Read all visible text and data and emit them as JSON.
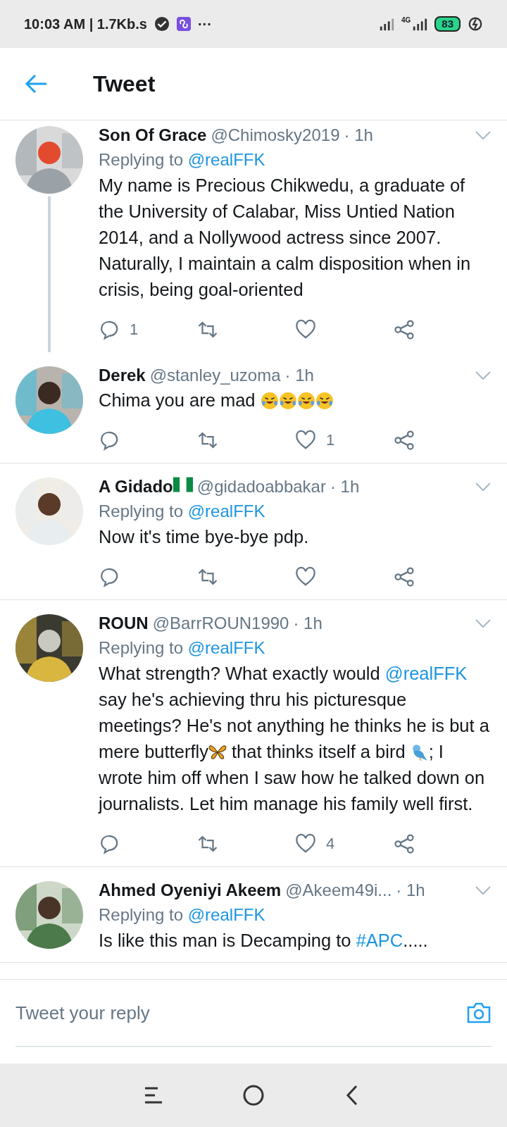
{
  "status_bar": {
    "time": "10:03 AM | 1.7Kb.s",
    "more": "···",
    "network": "4G",
    "battery": "83"
  },
  "header": {
    "title": "Tweet"
  },
  "tweets": [
    {
      "name": "Son Of Grace",
      "handle": "@Chimosky2019",
      "time": "· 1h",
      "thread_continues": true,
      "replying_to": {
        "label": "Replying to",
        "mention": "@realFFK"
      },
      "body": [
        {
          "kind": "text",
          "text": "My name is Precious Chikwedu, a graduate of the University of Calabar, Miss Untied Nation 2014, and a Nollywood actress since 2007. Naturally, I maintain a calm disposition when in crisis, being goal-oriented"
        }
      ],
      "actions": [
        {
          "kind": "reply",
          "count": "1"
        },
        {
          "kind": "retweet"
        },
        {
          "kind": "like"
        },
        {
          "kind": "share"
        }
      ]
    },
    {
      "name": "Derek",
      "handle": "@stanley_uzoma",
      "time": "· 1h",
      "thread_continues": false,
      "body": [
        {
          "kind": "text",
          "text": "Chima you are mad "
        },
        {
          "kind": "emoji_rofl"
        },
        {
          "kind": "emoji_rofl"
        },
        {
          "kind": "emoji_rofl"
        },
        {
          "kind": "emoji_rofl"
        }
      ],
      "actions": [
        {
          "kind": "reply"
        },
        {
          "kind": "retweet"
        },
        {
          "kind": "like",
          "count": "1"
        },
        {
          "kind": "share"
        }
      ]
    },
    {
      "name": "A Gidado",
      "name_badge": {
        "kind": "emoji_flag"
      },
      "handle": "@gidadoabbakar",
      "time": "· 1h",
      "thread_continues": false,
      "replying_to": {
        "label": "Replying to",
        "mention": "@realFFK"
      },
      "body": [
        {
          "kind": "text",
          "text": "Now it's time bye-bye pdp."
        }
      ],
      "actions": [
        {
          "kind": "reply"
        },
        {
          "kind": "retweet"
        },
        {
          "kind": "like"
        },
        {
          "kind": "share"
        }
      ]
    },
    {
      "name": "ROUN",
      "handle": "@BarrROUN1990",
      "time": "· 1h",
      "thread_continues": false,
      "replying_to": {
        "label": "Replying to",
        "mention": "@realFFK"
      },
      "body": [
        {
          "kind": "text",
          "text": "What strength? What exactly would "
        },
        {
          "kind": "mention",
          "text": "@realFFK"
        },
        {
          "kind": "text",
          "text": " say he's achieving thru his picturesque meetings? He's not anything he thinks he is but a mere butterfly"
        },
        {
          "kind": "emoji_butterfly"
        },
        {
          "kind": "text",
          "text": " that thinks itself a bird "
        },
        {
          "kind": "emoji_bird"
        },
        {
          "kind": "text",
          "text": "; I wrote him off when I saw how he talked down on journalists. Let him manage his family well first."
        }
      ],
      "actions": [
        {
          "kind": "reply"
        },
        {
          "kind": "retweet"
        },
        {
          "kind": "like",
          "count": "4"
        },
        {
          "kind": "share"
        }
      ]
    },
    {
      "name": "Ahmed Oyeniyi Akeem",
      "handle": "@Akeem49i...",
      "time": "· 1h",
      "thread_continues": false,
      "replying_to": {
        "label": "Replying to",
        "mention": "@realFFK"
      },
      "body": [
        {
          "kind": "text",
          "text": "Is like this man is Decamping to "
        },
        {
          "kind": "hashtag",
          "text": "#APC"
        },
        {
          "kind": "text",
          "text": "....."
        }
      ]
    }
  ],
  "reply_bar": {
    "placeholder": "Tweet your reply"
  }
}
